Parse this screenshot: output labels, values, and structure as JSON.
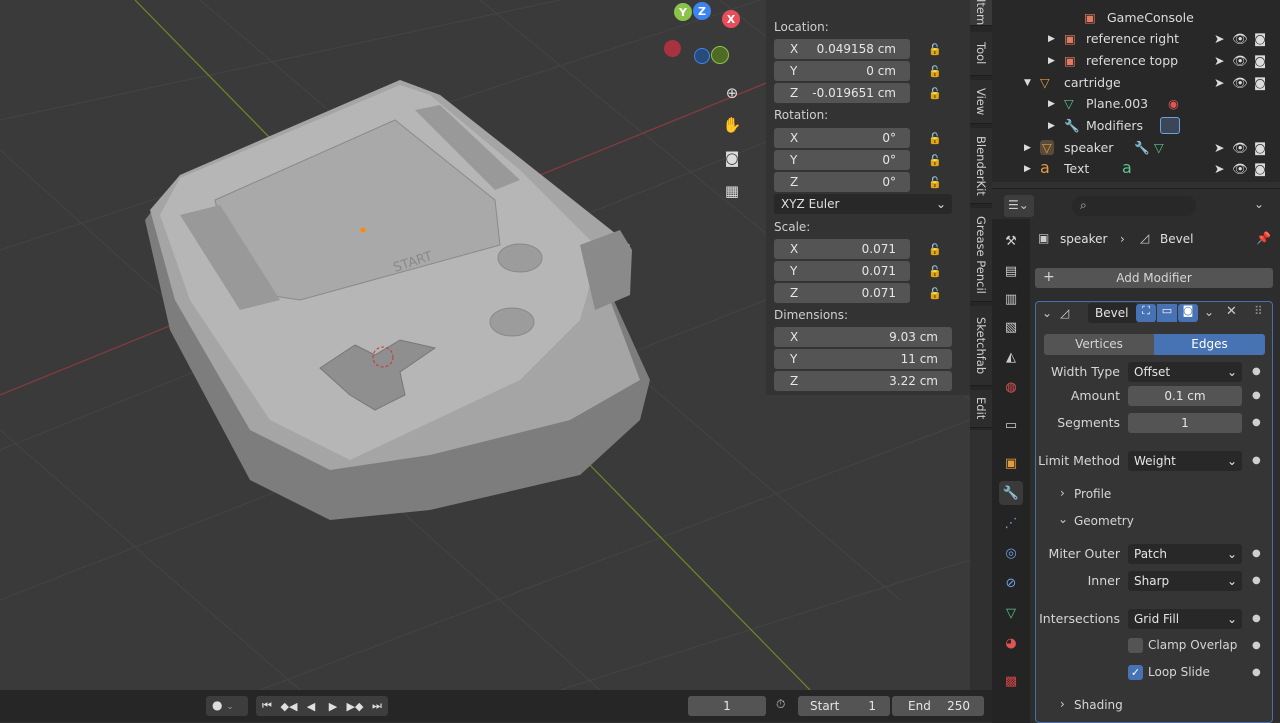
{
  "viewport": {
    "gizmo": {
      "x": "X",
      "y": "Y",
      "z": "Z"
    },
    "device_label": "START",
    "nav_icons": [
      "zoom-icon",
      "hand-pan-icon",
      "camera-icon",
      "grid-ortho-icon"
    ]
  },
  "npanel": {
    "location_label": "Location:",
    "location": [
      {
        "axis": "X",
        "value": "0.049158 cm"
      },
      {
        "axis": "Y",
        "value": "0 cm"
      },
      {
        "axis": "Z",
        "value": "-0.019651 cm"
      }
    ],
    "rotation_label": "Rotation:",
    "rotation": [
      {
        "axis": "X",
        "value": "0°"
      },
      {
        "axis": "Y",
        "value": "0°"
      },
      {
        "axis": "Z",
        "value": "0°"
      }
    ],
    "rotation_mode": "XYZ Euler",
    "scale_label": "Scale:",
    "scale": [
      {
        "axis": "X",
        "value": "0.071"
      },
      {
        "axis": "Y",
        "value": "0.071"
      },
      {
        "axis": "Z",
        "value": "0.071"
      }
    ],
    "dimensions_label": "Dimensions:",
    "dimensions": [
      {
        "axis": "X",
        "value": "9.03 cm"
      },
      {
        "axis": "Y",
        "value": "11 cm"
      },
      {
        "axis": "Z",
        "value": "3.22 cm"
      }
    ]
  },
  "vtabs": [
    "Item",
    "Tool",
    "View",
    "BlenderKit",
    "Grease Pencil",
    "Sketchfab",
    "Edit"
  ],
  "outliner": {
    "rows": [
      "GameConsole",
      "reference right",
      "reference topp",
      "cartridge",
      "Plane.003",
      "Modifiers",
      "speaker",
      "Text"
    ]
  },
  "properties": {
    "breadcrumb_object": "speaker",
    "breadcrumb_modifier": "Bevel",
    "add_modifier": "Add Modifier",
    "modifier_name": "Bevel",
    "tab_vertices": "Vertices",
    "tab_edges": "Edges",
    "width_type_label": "Width Type",
    "width_type_value": "Offset",
    "amount_label": "Amount",
    "amount_value": "0.1 cm",
    "segments_label": "Segments",
    "segments_value": "1",
    "limit_method_label": "Limit Method",
    "limit_method_value": "Weight",
    "profile_label": "Profile",
    "geometry_label": "Geometry",
    "miter_outer_label": "Miter Outer",
    "miter_outer_value": "Patch",
    "inner_label": "Inner",
    "inner_value": "Sharp",
    "intersections_label": "Intersections",
    "intersections_value": "Grid Fill",
    "clamp_overlap_label": "Clamp Overlap",
    "clamp_overlap_checked": false,
    "loop_slide_label": "Loop Slide",
    "loop_slide_checked": true,
    "shading_label": "Shading"
  },
  "timeline": {
    "current_frame": "1",
    "start_label": "Start",
    "start_value": "1",
    "end_label": "End",
    "end_value": "250"
  },
  "colors": {
    "accent": "#4772b3",
    "x_axis": "#e84d5c",
    "y_axis": "#8bc34a",
    "z_axis": "#3c84f0"
  }
}
